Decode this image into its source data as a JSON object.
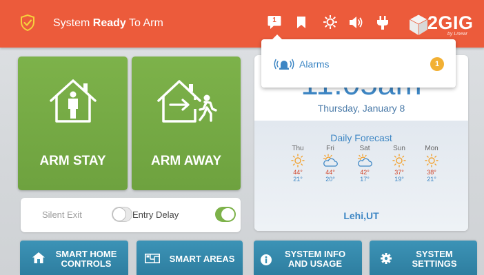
{
  "status_bar": {
    "status_prefix": "System ",
    "status_bold": "Ready",
    "status_suffix": " To Arm",
    "message_count": "1",
    "icons": [
      "shield-check-icon",
      "message-icon",
      "bookmark-icon",
      "brightness-icon",
      "volume-icon",
      "plug-icon"
    ],
    "logo_text": "2GIG",
    "logo_subtext": "by Linear",
    "color": "#ec5b3b"
  },
  "arm_buttons": {
    "stay_label": "ARM STAY",
    "away_label": "ARM AWAY",
    "color": "#7db24a"
  },
  "toggles": {
    "silent_exit": {
      "label": "Silent Exit",
      "on": false
    },
    "entry_delay": {
      "label": "Entry Delay",
      "on": true
    }
  },
  "clock": {
    "time": "11:05am",
    "date": "Thursday, January 8"
  },
  "weather": {
    "title": "Daily Forecast",
    "days": [
      {
        "day": "Thu",
        "icon": "sun-icon",
        "high": "44°",
        "low": "21°"
      },
      {
        "day": "Fri",
        "icon": "partly-cloudy-icon",
        "high": "44°",
        "low": "20°"
      },
      {
        "day": "Sat",
        "icon": "partly-cloudy-icon",
        "high": "42°",
        "low": "17°"
      },
      {
        "day": "Sun",
        "icon": "sun-icon",
        "high": "37°",
        "low": "19°"
      },
      {
        "day": "Mon",
        "icon": "sun-icon",
        "high": "38°",
        "low": "21°"
      }
    ],
    "location": "Lehi,UT"
  },
  "alarms_popup": {
    "label": "Alarms",
    "count": "1",
    "icon": "siren-icon",
    "badge_color": "#f2b033"
  },
  "bottom_nav": {
    "smart_home_line1": "SMART HOME",
    "smart_home_line2": "CONTROLS",
    "smart_areas": "SMART AREAS",
    "system_info_line1": "SYSTEM INFO",
    "system_info_line2": "AND USAGE",
    "system_settings_line1": "SYSTEM",
    "system_settings_line2": "SETTINGS",
    "color": "#3c93b6"
  }
}
